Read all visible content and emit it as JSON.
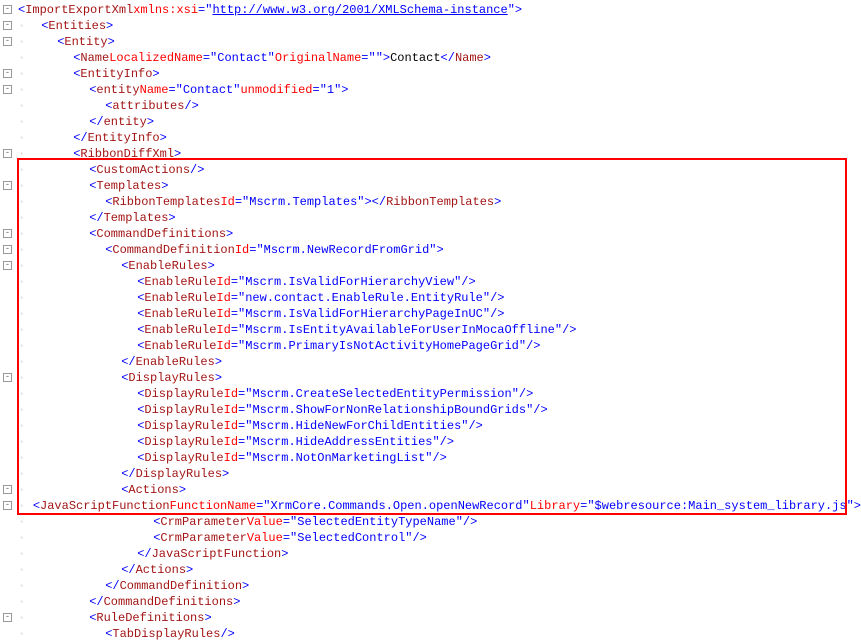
{
  "xml": {
    "root": "ImportExportXml",
    "xmlns_attr": "xmlns:xsi",
    "xmlns_url": "http://www.w3.org/2001/XMLSchema-instance",
    "entities": "Entities",
    "entity": "Entity",
    "name_tag": "Name",
    "localized_attr": "LocalizedName",
    "localized_val": "Contact",
    "original_attr": "OriginalName",
    "original_val": "",
    "name_text": "Contact",
    "entityinfo": "EntityInfo",
    "entity_lower": "entity",
    "entity_name_attr": "Name",
    "entity_name_val": "Contact",
    "unmodified_attr": "unmodified",
    "unmodified_val": "1",
    "attributes": "attributes",
    "ribbondiffxml": "RibbonDiffXml",
    "customactions": "CustomActions",
    "templates": "Templates",
    "ribbontemplates": "RibbonTemplates",
    "ribbontemplates_id_attr": "Id",
    "ribbontemplates_id_val": "Mscrm.Templates",
    "commanddefinitions": "CommandDefinitions",
    "commanddefinition": "CommandDefinition",
    "commanddef_id_attr": "Id",
    "commanddef_id_val": "Mscrm.NewRecordFromGrid",
    "enablerules": "EnableRules",
    "enablerule": "EnableRule",
    "enablerule_ids": [
      "Mscrm.IsValidForHierarchyView",
      "new.contact.EnableRule.EntityRule",
      "Mscrm.IsValidForHierarchyPageInUC",
      "Mscrm.IsEntityAvailableForUserInMocaOffline",
      "Mscrm.PrimaryIsNotActivityHomePageGrid"
    ],
    "displayrules": "DisplayRules",
    "displayrule": "DisplayRule",
    "displayrule_ids": [
      "Mscrm.CreateSelectedEntityPermission",
      "Mscrm.ShowForNonRelationshipBoundGrids",
      "Mscrm.HideNewForChildEntities",
      "Mscrm.HideAddressEntities",
      "Mscrm.NotOnMarketingList"
    ],
    "actions": "Actions",
    "jsfunc": "JavaScriptFunction",
    "funcname_attr": "FunctionName",
    "funcname_val": "XrmCore.Commands.Open.openNewRecord",
    "library_attr": "Library",
    "library_val": "$webresource:Main_system_library.js",
    "crmparam": "CrmParameter",
    "value_attr": "Value",
    "crmparam_vals": [
      "SelectedEntityTypeName",
      "SelectedControl"
    ],
    "ruledefinitions": "RuleDefinitions",
    "tabdisplayrules": "TabDisplayRules",
    "id_attr": "Id"
  }
}
